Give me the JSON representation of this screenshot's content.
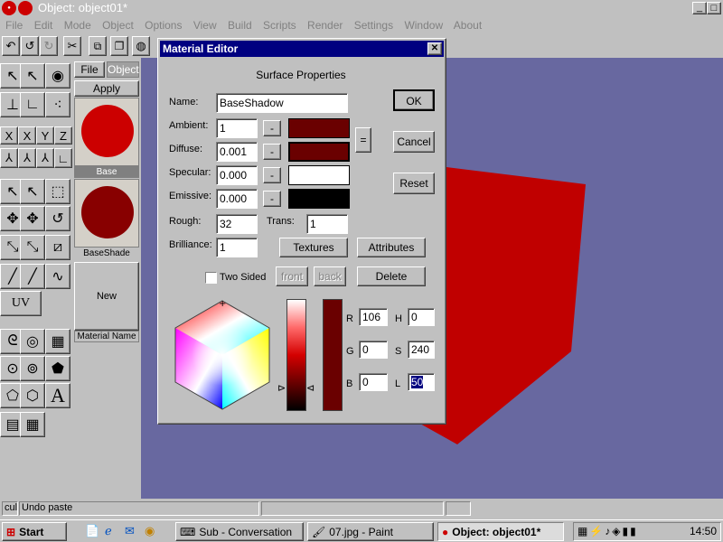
{
  "app": {
    "title": "Object: object01*",
    "menus": [
      "File",
      "Edit",
      "Mode",
      "Object",
      "Options",
      "View",
      "Build",
      "Scripts",
      "Render",
      "Settings",
      "Window",
      "About"
    ],
    "minimize_glyph": "_",
    "restore_glyph": "□"
  },
  "panel": {
    "tabs": [
      "File",
      "Object"
    ],
    "apply_label": "Apply",
    "materials": [
      {
        "name": "Base",
        "color": "#cc0000"
      },
      {
        "name": "BaseShade",
        "color": "#880000"
      }
    ],
    "new_label": "New",
    "material_name_label": "Material Name"
  },
  "tools": {
    "axis_x": "X",
    "axis_y": "Y",
    "axis_z": "Z",
    "axis_x2": "X",
    "uv_label": "UV"
  },
  "dialog": {
    "title": "Material Editor",
    "close_glyph": "✕",
    "section": "Surface Properties",
    "name_label": "Name:",
    "name_value": "BaseShadow",
    "ambient_label": "Ambient:",
    "ambient_value": "1",
    "ambient_color": "#6a0000",
    "diffuse_label": "Diffuse:",
    "diffuse_value": "0.001",
    "diffuse_color": "#6a0000",
    "specular_label": "Specular:",
    "specular_value": "0.000",
    "specular_color": "#ffffff",
    "emissive_label": "Emissive:",
    "emissive_value": "0.000",
    "emissive_color": "#000000",
    "minus_label": "-",
    "equals_label": "=",
    "rough_label": "Rough:",
    "rough_value": "32",
    "trans_label": "Trans:",
    "trans_value": "1",
    "brilliance_label": "Brilliance:",
    "brilliance_value": "1",
    "textures_label": "Textures",
    "attributes_label": "Attributes",
    "two_sided_label": "Two Sided",
    "front_label": "front",
    "back_label": "back",
    "delete_label": "Delete",
    "ok_label": "OK",
    "cancel_label": "Cancel",
    "reset_label": "Reset",
    "r_label": "R",
    "r_value": "106",
    "g_label": "G",
    "g_value": "0",
    "b_label": "B",
    "b_value": "0",
    "h_label": "H",
    "h_value": "0",
    "s_label": "S",
    "s_value": "240",
    "l_label": "L",
    "l_value": "50"
  },
  "status": {
    "left": "cul",
    "message": "Undo paste"
  },
  "taskbar": {
    "start_label": "Start",
    "buttons": [
      "Sub - Conversation",
      "07.jpg - Paint",
      "Object: object01*"
    ],
    "clock": "14:50"
  },
  "colors": {
    "viewport": "#6868a0",
    "cube": "#c00000",
    "titlebar": "#000080"
  }
}
